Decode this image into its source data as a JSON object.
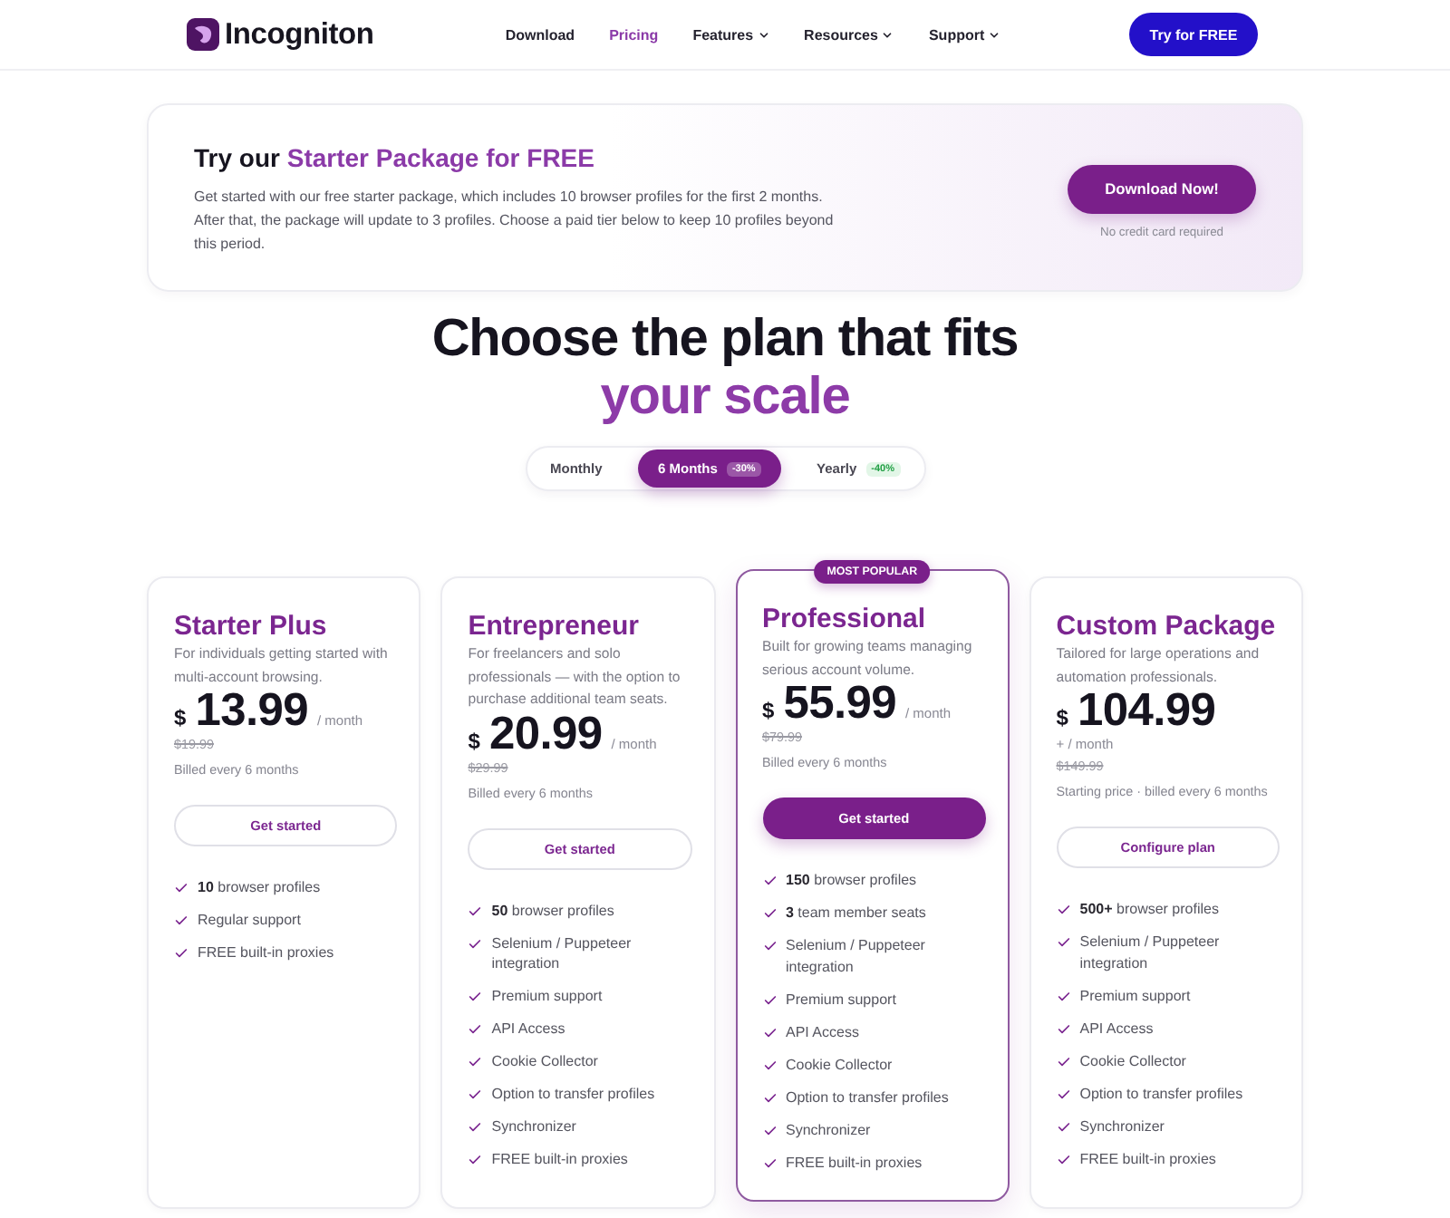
{
  "header": {
    "brand": "Incogniton",
    "nav": [
      {
        "label": "Download",
        "selected": false,
        "dropdown": false
      },
      {
        "label": "Pricing",
        "selected": true,
        "dropdown": false
      },
      {
        "label": "Features",
        "selected": false,
        "dropdown": true
      },
      {
        "label": "Resources",
        "selected": false,
        "dropdown": true
      },
      {
        "label": "Support",
        "selected": false,
        "dropdown": true
      }
    ],
    "cta": "Try for FREE"
  },
  "promo": {
    "title_lead": "Try our",
    "title_highlight": "Starter Package for FREE",
    "text": "Get started with our free starter package, which includes 10 browser profiles for the first 2 months. After that, the package will update to 3 profiles. Choose a paid tier below to keep 10 profiles beyond this period.",
    "button": "Download Now!",
    "note": "No credit card required"
  },
  "heading": {
    "line_1": "Choose the plan that fits",
    "line_2": "your scale"
  },
  "billing_toggle": [
    {
      "label": "Monthly",
      "selected": false
    },
    {
      "label": "6 Months",
      "selected": true,
      "badge": "-30%"
    },
    {
      "label": "Yearly",
      "selected": false,
      "badge": "-40%"
    }
  ],
  "plans": [
    {
      "name": "Starter Plus",
      "popular": false,
      "description": "For individuals getting started with multi-account browsing.",
      "currency": "$",
      "price": "13.99",
      "period": "/ month",
      "old_price": "$19.99",
      "billing": "Billed every 6 months",
      "button": "Get started",
      "features": [
        "**10** browser profiles",
        "Regular support",
        "FREE built-in proxies"
      ]
    },
    {
      "name": "Entrepreneur",
      "popular": false,
      "description": "For freelancers and solo professionals — with the option to purchase additional team seats.",
      "currency": "$",
      "price": "20.99",
      "period": "/ month",
      "old_price": "$29.99",
      "billing": "Billed every 6 months",
      "button": "Get started",
      "features": [
        "**50** browser profiles",
        "Selenium / Puppeteer integration",
        "Premium support",
        "API Access",
        "Cookie Collector",
        "Option to transfer profiles",
        "Synchronizer",
        "FREE built-in proxies"
      ]
    },
    {
      "name": "Professional",
      "popular": true,
      "badge": "MOST POPULAR",
      "description": "Built for growing teams managing serious account volume.",
      "currency": "$",
      "price": "55.99",
      "period": "/ month",
      "old_price": "$79.99",
      "billing": "Billed every 6 months",
      "button": "Get started",
      "features": [
        "**150** browser profiles",
        "**3** team member seats",
        "Selenium / Puppeteer integration",
        "Premium support",
        "API Access",
        "Cookie Collector",
        "Option to transfer profiles",
        "Synchronizer",
        "FREE built-in proxies"
      ]
    },
    {
      "name": "Custom Package",
      "popular": false,
      "description": "Tailored for large operations and automation professionals.",
      "currency": "$",
      "price": "104.99",
      "period": "+ / month",
      "old_price": "$149.99",
      "billing": "Starting price · billed every 6 months",
      "button": "Configure plan",
      "features": [
        "**500+** browser profiles",
        "Selenium / Puppeteer integration",
        "Premium support",
        "API Access",
        "Cookie Collector",
        "Option to transfer profiles",
        "Synchronizer",
        "FREE built-in proxies"
      ]
    }
  ]
}
